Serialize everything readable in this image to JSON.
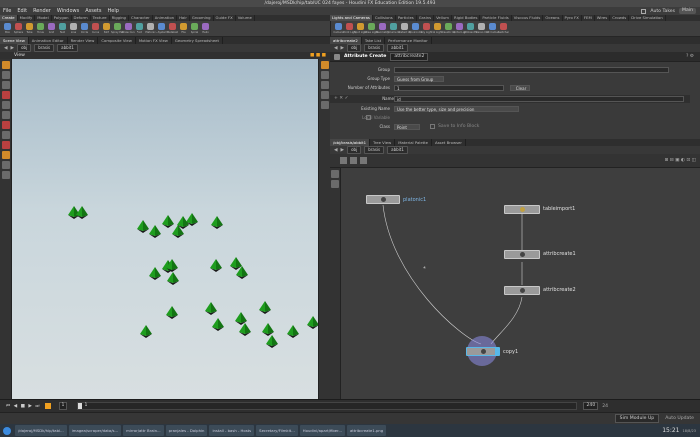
{
  "window": {
    "title": "/dajeroj/MSDk/hip/tablUC 024 fayes - Houdini FX Education Edition 19.5.493"
  },
  "menubar": {
    "items": [
      "File",
      "Edit",
      "Render",
      "Windows",
      "Assets",
      "Help"
    ],
    "auto_takes": "Auto Takes",
    "main": "Main"
  },
  "shelf_tabs_left": [
    "Create",
    "Modify",
    "Model",
    "Polygon",
    "Deform",
    "Texture",
    "Rigging",
    "Character",
    "Animation",
    "Hair",
    "Grooming",
    "Guide FX",
    "Volume"
  ],
  "shelf_tabs_right": [
    "Lights and Cameras",
    "Collisions",
    "Particles",
    "Grains",
    "Vellum",
    "Rigid Bodies",
    "Particle Fluids",
    "Viscous Fluids",
    "Oceans",
    "Pyro FX",
    "FEM",
    "Wires",
    "Crowds",
    "Drive Simulation"
  ],
  "shelf_tools_left": [
    "Box",
    "Sphere",
    "Tube",
    "Torus",
    "Grid",
    "Null",
    "Line",
    "Circle",
    "Curve",
    "Path",
    "Spray Paint",
    "Draw Curve",
    "Font",
    "Platonic",
    "L-System",
    "Metaball",
    "File",
    "Spiral",
    "Helix"
  ],
  "shelf_tools_right": [
    "Camera",
    "Point Light",
    "Spot Light",
    "Area Light",
    "Geometry Light",
    "Volume Light",
    "Distant Light",
    "Environment Light",
    "Sky Light",
    "GI Light",
    "Caustic Light",
    "Portal Light",
    "Ambient Light",
    "Stereo Cam",
    "VR Camera",
    "Switcher"
  ],
  "left_pane": {
    "tabs": [
      "Scene View",
      "Animation Editor",
      "Render View",
      "Composite View",
      "Motion FX View",
      "Geometry Spreadsheet"
    ],
    "path": [
      "obj",
      "brasis",
      "abbit1"
    ],
    "viewport_label": "View",
    "frame_start": "1",
    "frame_current": "1",
    "frame_end": "240",
    "fps_label": "24"
  },
  "right_pane": {
    "tabs": [
      "attribcreate2",
      "Take List",
      "Performance Monitor"
    ],
    "path": [
      "obj",
      "brasis",
      "abbit1"
    ]
  },
  "parameters": {
    "node_type": "Attribute Create",
    "node_name": "attribcreate2",
    "group_label": "Group",
    "group_value": "",
    "group_type_label": "Group Type",
    "group_type_value": "Guess from Group",
    "num_attr_label": "Number of Attributes",
    "num_attr_value": "1",
    "clear_label": "Clear",
    "name_label": "Name",
    "name_value": "id",
    "existing_label": "Existing Name",
    "existing_value": "Use the better type, size and precision",
    "local_var_label": "Local Variable",
    "class_label": "Class",
    "class_value": "Point",
    "save_info": "Save to Info Block"
  },
  "network": {
    "tabs": [
      "/obj/brasis/abbit1",
      "Tree View",
      "Material Palette",
      "Asset Browser"
    ],
    "path": [
      "obj",
      "brasis",
      "abbit1"
    ],
    "nodes": [
      "platonic1",
      "tableimport1",
      "attribcreate1",
      "attribcreate2",
      "copy1"
    ]
  },
  "status": {
    "sim_label": "Sim Module Up",
    "auto_update": "Auto Update"
  },
  "taskbar": {
    "items": [
      "/dajeroj/MSDk/hip/tabl...",
      "imagea/scraper/data/s...",
      "mirror/attr Brain...",
      "pranjales - Dolphin",
      "install - bash - Hosts",
      "Secretary/Filmkit...",
      "Houdini/apart/fiber...",
      "attribcreate1.png"
    ],
    "clock": "15:21",
    "date": "18/8/23"
  },
  "colors": {
    "accent": "#f0a020",
    "triangle": "#1e9d1e",
    "node_selected": "#58b8e8"
  }
}
